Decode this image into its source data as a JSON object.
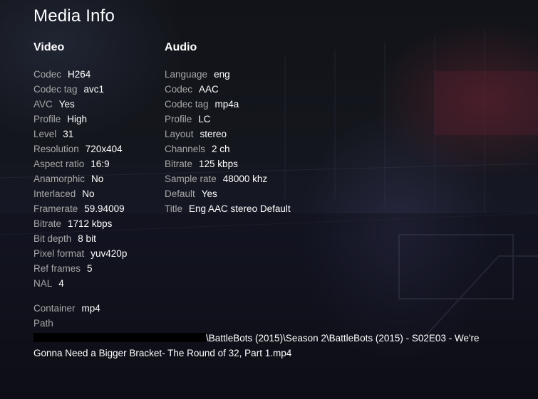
{
  "title": "Media Info",
  "video": {
    "heading": "Video",
    "fields": [
      {
        "label": "Codec",
        "value": "H264"
      },
      {
        "label": "Codec tag",
        "value": "avc1"
      },
      {
        "label": "AVC",
        "value": "Yes"
      },
      {
        "label": "Profile",
        "value": "High"
      },
      {
        "label": "Level",
        "value": "31"
      },
      {
        "label": "Resolution",
        "value": "720x404"
      },
      {
        "label": "Aspect ratio",
        "value": "16:9"
      },
      {
        "label": "Anamorphic",
        "value": "No"
      },
      {
        "label": "Interlaced",
        "value": "No"
      },
      {
        "label": "Framerate",
        "value": "59.94009"
      },
      {
        "label": "Bitrate",
        "value": "1712 kbps"
      },
      {
        "label": "Bit depth",
        "value": "8 bit"
      },
      {
        "label": "Pixel format",
        "value": "yuv420p"
      },
      {
        "label": "Ref frames",
        "value": "5"
      },
      {
        "label": "NAL",
        "value": "4"
      }
    ]
  },
  "audio": {
    "heading": "Audio",
    "fields": [
      {
        "label": "Language",
        "value": "eng"
      },
      {
        "label": "Codec",
        "value": "AAC"
      },
      {
        "label": "Codec tag",
        "value": "mp4a"
      },
      {
        "label": "Profile",
        "value": "LC"
      },
      {
        "label": "Layout",
        "value": "stereo"
      },
      {
        "label": "Channels",
        "value": "2 ch"
      },
      {
        "label": "Bitrate",
        "value": "125 kbps"
      },
      {
        "label": "Sample rate",
        "value": "48000 khz"
      },
      {
        "label": "Default",
        "value": "Yes"
      },
      {
        "label": "Title",
        "value": "Eng AAC stereo Default"
      }
    ]
  },
  "file": {
    "container_label": "Container",
    "container_value": "mp4",
    "path_label": "Path",
    "path_value": "\\BattleBots (2015)\\Season 2\\BattleBots (2015) - S02E03 - We're Gonna Need a Bigger Bracket- The Round of 32, Part 1.mp4"
  }
}
